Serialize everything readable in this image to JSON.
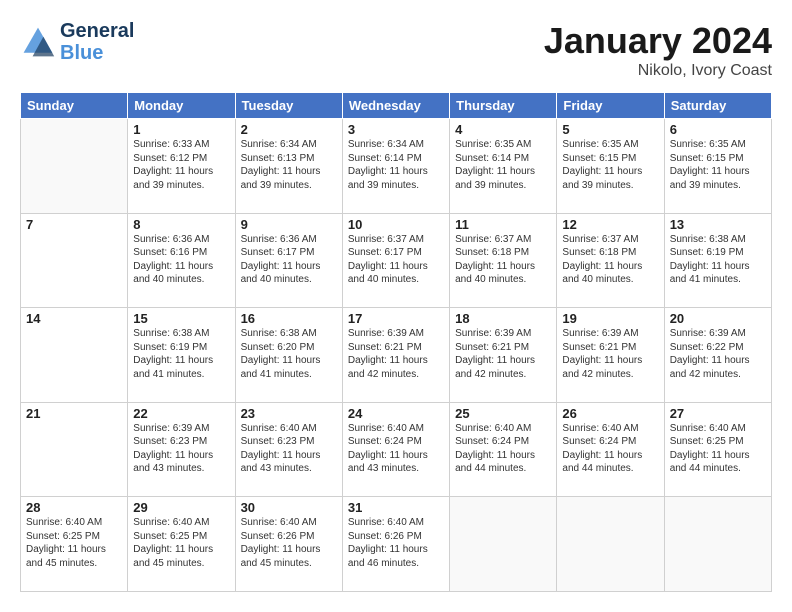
{
  "logo": {
    "line1": "General",
    "line2": "Blue"
  },
  "header": {
    "month": "January 2024",
    "location": "Nikolo, Ivory Coast"
  },
  "weekdays": [
    "Sunday",
    "Monday",
    "Tuesday",
    "Wednesday",
    "Thursday",
    "Friday",
    "Saturday"
  ],
  "weeks": [
    [
      {
        "day": "",
        "info": ""
      },
      {
        "day": "1",
        "info": "Sunrise: 6:33 AM\nSunset: 6:12 PM\nDaylight: 11 hours\nand 39 minutes."
      },
      {
        "day": "2",
        "info": "Sunrise: 6:34 AM\nSunset: 6:13 PM\nDaylight: 11 hours\nand 39 minutes."
      },
      {
        "day": "3",
        "info": "Sunrise: 6:34 AM\nSunset: 6:14 PM\nDaylight: 11 hours\nand 39 minutes."
      },
      {
        "day": "4",
        "info": "Sunrise: 6:35 AM\nSunset: 6:14 PM\nDaylight: 11 hours\nand 39 minutes."
      },
      {
        "day": "5",
        "info": "Sunrise: 6:35 AM\nSunset: 6:15 PM\nDaylight: 11 hours\nand 39 minutes."
      },
      {
        "day": "6",
        "info": "Sunrise: 6:35 AM\nSunset: 6:15 PM\nDaylight: 11 hours\nand 39 minutes."
      }
    ],
    [
      {
        "day": "7",
        "info": ""
      },
      {
        "day": "8",
        "info": "Sunrise: 6:36 AM\nSunset: 6:16 PM\nDaylight: 11 hours\nand 40 minutes."
      },
      {
        "day": "9",
        "info": "Sunrise: 6:36 AM\nSunset: 6:17 PM\nDaylight: 11 hours\nand 40 minutes."
      },
      {
        "day": "10",
        "info": "Sunrise: 6:37 AM\nSunset: 6:17 PM\nDaylight: 11 hours\nand 40 minutes."
      },
      {
        "day": "11",
        "info": "Sunrise: 6:37 AM\nSunset: 6:18 PM\nDaylight: 11 hours\nand 40 minutes."
      },
      {
        "day": "12",
        "info": "Sunrise: 6:37 AM\nSunset: 6:18 PM\nDaylight: 11 hours\nand 40 minutes."
      },
      {
        "day": "13",
        "info": "Sunrise: 6:38 AM\nSunset: 6:19 PM\nDaylight: 11 hours\nand 41 minutes."
      }
    ],
    [
      {
        "day": "14",
        "info": ""
      },
      {
        "day": "15",
        "info": "Sunrise: 6:38 AM\nSunset: 6:19 PM\nDaylight: 11 hours\nand 41 minutes."
      },
      {
        "day": "16",
        "info": "Sunrise: 6:38 AM\nSunset: 6:20 PM\nDaylight: 11 hours\nand 41 minutes."
      },
      {
        "day": "17",
        "info": "Sunrise: 6:39 AM\nSunset: 6:21 PM\nDaylight: 11 hours\nand 42 minutes."
      },
      {
        "day": "18",
        "info": "Sunrise: 6:39 AM\nSunset: 6:21 PM\nDaylight: 11 hours\nand 42 minutes."
      },
      {
        "day": "19",
        "info": "Sunrise: 6:39 AM\nSunset: 6:21 PM\nDaylight: 11 hours\nand 42 minutes."
      },
      {
        "day": "20",
        "info": "Sunrise: 6:39 AM\nSunset: 6:22 PM\nDaylight: 11 hours\nand 42 minutes."
      }
    ],
    [
      {
        "day": "21",
        "info": ""
      },
      {
        "day": "22",
        "info": "Sunrise: 6:39 AM\nSunset: 6:23 PM\nDaylight: 11 hours\nand 43 minutes."
      },
      {
        "day": "23",
        "info": "Sunrise: 6:40 AM\nSunset: 6:23 PM\nDaylight: 11 hours\nand 43 minutes."
      },
      {
        "day": "24",
        "info": "Sunrise: 6:40 AM\nSunset: 6:24 PM\nDaylight: 11 hours\nand 43 minutes."
      },
      {
        "day": "25",
        "info": "Sunrise: 6:40 AM\nSunset: 6:24 PM\nDaylight: 11 hours\nand 44 minutes."
      },
      {
        "day": "26",
        "info": "Sunrise: 6:40 AM\nSunset: 6:24 PM\nDaylight: 11 hours\nand 44 minutes."
      },
      {
        "day": "27",
        "info": "Sunrise: 6:40 AM\nSunset: 6:25 PM\nDaylight: 11 hours\nand 44 minutes."
      }
    ],
    [
      {
        "day": "28",
        "info": "Sunrise: 6:40 AM\nSunset: 6:25 PM\nDaylight: 11 hours\nand 45 minutes."
      },
      {
        "day": "29",
        "info": "Sunrise: 6:40 AM\nSunset: 6:25 PM\nDaylight: 11 hours\nand 45 minutes."
      },
      {
        "day": "30",
        "info": "Sunrise: 6:40 AM\nSunset: 6:26 PM\nDaylight: 11 hours\nand 45 minutes."
      },
      {
        "day": "31",
        "info": "Sunrise: 6:40 AM\nSunset: 6:26 PM\nDaylight: 11 hours\nand 46 minutes."
      },
      {
        "day": "",
        "info": ""
      },
      {
        "day": "",
        "info": ""
      },
      {
        "day": "",
        "info": ""
      }
    ]
  ]
}
